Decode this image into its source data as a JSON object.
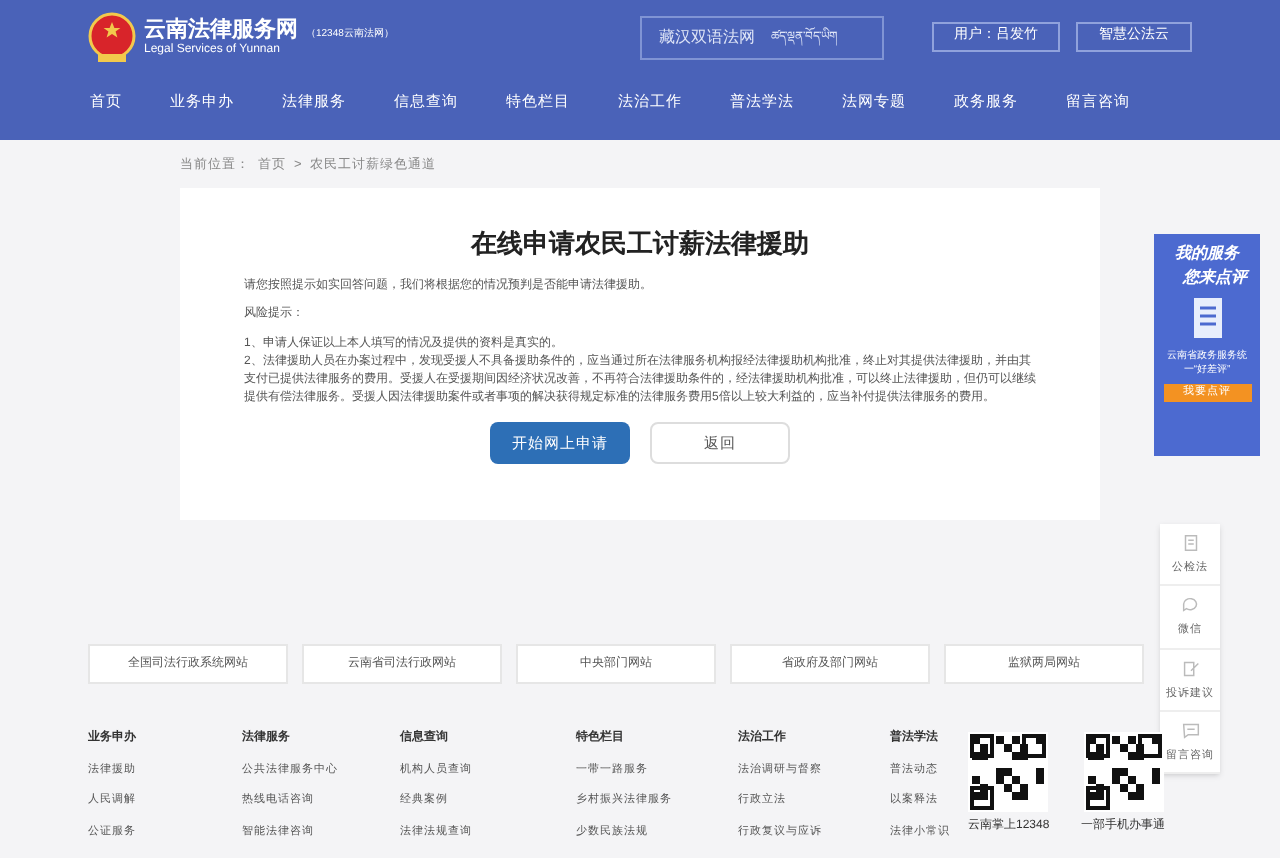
{
  "header": {
    "site_title": "云南法律服务网",
    "hotline": "（12348云南法网）",
    "subtitle": "Legal Services of Yunnan",
    "language_switch": {
      "chinese": "藏汉双语法网",
      "tibetan": "ཚད་ལྡན་བོད་ཡིག"
    },
    "user_button": "用户：吕发竹",
    "cloud_button": "智慧公法云"
  },
  "nav": [
    {
      "label": "首页",
      "selected": false
    },
    {
      "label": "业务申办",
      "selected": false
    },
    {
      "label": "法律服务",
      "selected": false
    },
    {
      "label": "信息查询",
      "selected": false
    },
    {
      "label": "特色栏目",
      "selected": false
    },
    {
      "label": "法治工作",
      "selected": false
    },
    {
      "label": "普法学法",
      "selected": false
    },
    {
      "label": "法网专题",
      "selected": false
    },
    {
      "label": "政务服务",
      "selected": false
    },
    {
      "label": "留言咨询",
      "selected": false
    }
  ],
  "breadcrumb": {
    "prefix": "当前位置：",
    "separator": ">",
    "items": [
      "首页",
      "农民工讨薪绿色通道"
    ]
  },
  "card": {
    "title": "在线申请农民工讨薪法律援助",
    "intro": "请您按照提示如实回答问题，我们将根据您的情况预判是否能申请法律援助。",
    "risk_heading": "风险提示：",
    "risk_items": [
      "1、申请人保证以上本人填写的情况及提供的资料是真实的。",
      "2、法律援助人员在办案过程中，发现受援人不具备援助条件的，应当通过所在法律服务机构报经法律援助机构批准，终止对其提供法律援助，并由其支付已提供法律服务的费用。受援人在受援期间因经济状况改善，不再符合法律援助条件的，经法律援助机构批准，可以终止法律援助，但仍可以继续提供有偿法律服务。受援人因法律援助案件或者事项的解决获得规定标准的法律服务费用5倍以上较大利益的，应当补付提供法律服务的费用。"
    ],
    "primary_button": "开始网上申请",
    "back_button": "返回"
  },
  "side_ad": {
    "line1": "我的服务",
    "line2": "您来点评",
    "caption": "云南省政务服务统一“好差评”",
    "button": "我要点评"
  },
  "float_panel": [
    "公检法",
    "微信",
    "投诉建议",
    "留言咨询"
  ],
  "site_links": [
    "全国司法行政系统网站",
    "云南省司法行政网站",
    "中央部门网站",
    "省政府及部门网站",
    "监狱两局网站"
  ],
  "footer_columns": [
    {
      "heading": "业务申办",
      "links": [
        "法律援助",
        "人民调解",
        "公证服务"
      ]
    },
    {
      "heading": "法律服务",
      "links": [
        "公共法律服务中心",
        "热线电话咨询",
        "智能法律咨询"
      ]
    },
    {
      "heading": "信息查询",
      "links": [
        "机构人员查询",
        "经典案例",
        "法律法规查询"
      ]
    },
    {
      "heading": "特色栏目",
      "links": [
        "一带一路服务",
        "乡村振兴法律服务",
        "少数民族法规"
      ]
    },
    {
      "heading": "法治工作",
      "links": [
        "法治调研与督察",
        "行政立法",
        "行政复议与应诉"
      ]
    },
    {
      "heading": "普法学法",
      "links": [
        "普法动态",
        "以案释法",
        "法律小常识"
      ]
    }
  ],
  "qr_codes": [
    "云南掌上12348",
    "一部手机办事通"
  ]
}
